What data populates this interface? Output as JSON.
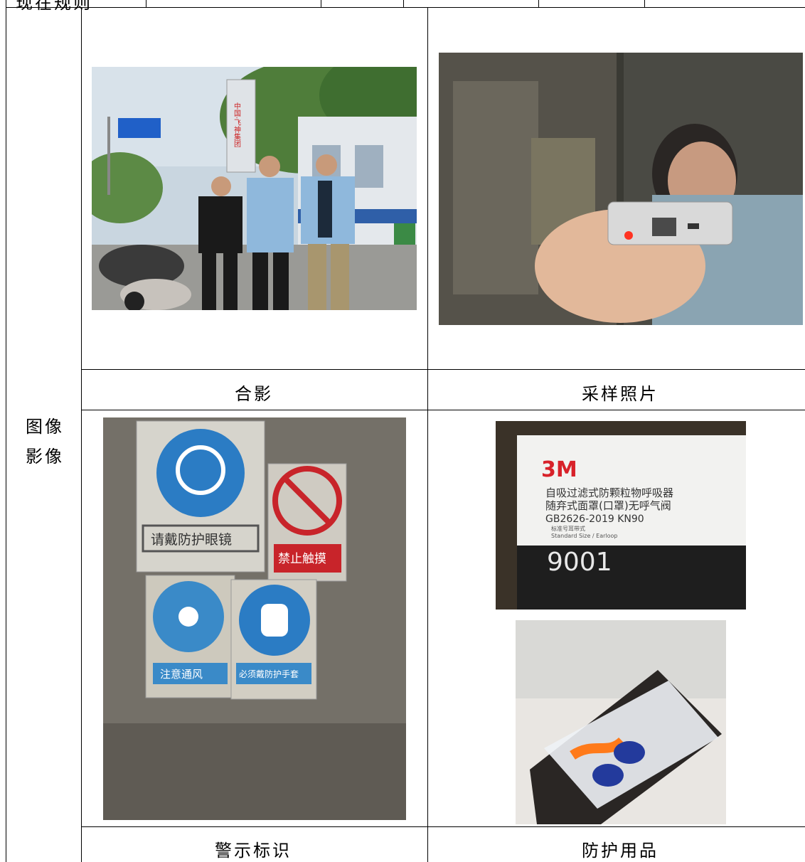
{
  "header_partial": {
    "label": "现在规则"
  },
  "section": {
    "label_line1": "图像",
    "label_line2": "影像"
  },
  "captions": {
    "group_photo": "合影",
    "sampling_photo": "采样照片",
    "warning_signs": "警示标识",
    "protective_equipment": "防护用品"
  },
  "photo_text": {
    "company_sign": "中国·飞神集团",
    "sign_goggles": "请戴防护眼镜",
    "sign_no_touch": "禁止触摸",
    "sign_ventilation": "注意通风",
    "sign_gloves": "必须戴防护手套",
    "mask_brand": "3M",
    "mask_desc_1": "自吸过滤式防颗粒物呼吸器",
    "mask_desc_2": "随弃式面罩(口罩)无呼气阀",
    "mask_std": "GB2626-2019 KN90",
    "mask_size_cn": "标准号耳带式",
    "mask_size_en": "Standard Size / Earloop",
    "mask_model": "9001"
  }
}
